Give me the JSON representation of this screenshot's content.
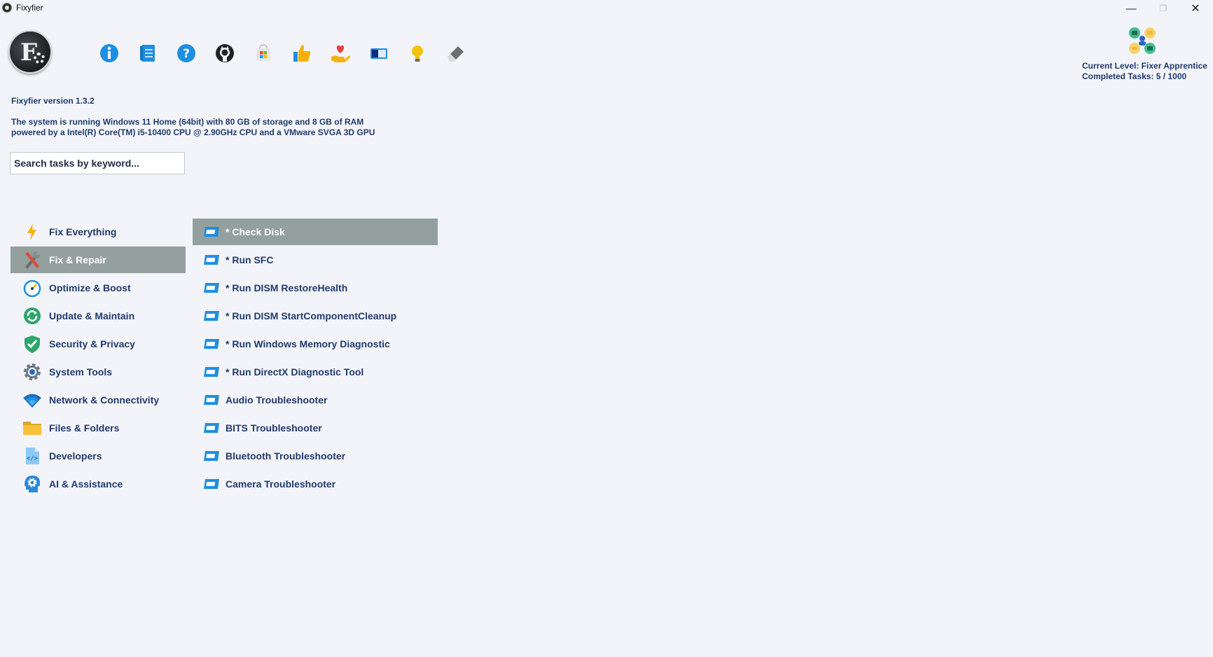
{
  "window": {
    "title": "Fixyfier",
    "minimize_glyph": "—",
    "maximize_glyph": "❐",
    "close_glyph": "✕"
  },
  "toolbar": {
    "icons": [
      "info-icon",
      "notes-icon",
      "help-icon",
      "github-icon",
      "store-icon",
      "like-icon",
      "donate-icon",
      "toggle-icon",
      "lightbulb-icon",
      "eraser-icon"
    ]
  },
  "level": {
    "current": "Current Level: Fixer Apprentice",
    "completed": "Completed Tasks: 5 / 1000"
  },
  "info": {
    "version": "Fixyfier version 1.3.2",
    "system_line1": "The system is running Windows 11 Home (64bit) with 80 GB of storage and 8 GB of RAM",
    "system_line2": "powered by a Intel(R) Core(TM) i5-10400 CPU @ 2.90GHz CPU and a VMware SVGA 3D GPU"
  },
  "search": {
    "placeholder": "Search tasks by keyword..."
  },
  "categories": [
    {
      "label": "Fix Everything",
      "icon": "lightning-icon"
    },
    {
      "label": "Fix & Repair",
      "icon": "tools-icon",
      "selected": true
    },
    {
      "label": "Optimize & Boost",
      "icon": "gauge-icon"
    },
    {
      "label": "Update & Maintain",
      "icon": "refresh-icon"
    },
    {
      "label": "Security & Privacy",
      "icon": "shield-icon"
    },
    {
      "label": "System Tools",
      "icon": "gear-icon"
    },
    {
      "label": "Network & Connectivity",
      "icon": "wifi-icon"
    },
    {
      "label": "Files & Folders",
      "icon": "folder-icon"
    },
    {
      "label": "Developers",
      "icon": "code-file-icon"
    },
    {
      "label": "AI & Assistance",
      "icon": "ai-head-icon"
    }
  ],
  "tasks": [
    {
      "label": "* Check Disk",
      "selected": true
    },
    {
      "label": "* Run SFC"
    },
    {
      "label": "* Run DISM RestoreHealth"
    },
    {
      "label": "* Run DISM StartComponentCleanup"
    },
    {
      "label": "* Run Windows Memory Diagnostic"
    },
    {
      "label": "* Run DirectX Diagnostic Tool"
    },
    {
      "label": "Audio Troubleshooter"
    },
    {
      "label": "BITS Troubleshooter"
    },
    {
      "label": "Bluetooth Troubleshooter"
    },
    {
      "label": "Camera Troubleshooter"
    }
  ],
  "colors": {
    "accent_text": "#1f3b6e",
    "selected_bg": "#94a09e",
    "background": "#f3f4f9"
  }
}
